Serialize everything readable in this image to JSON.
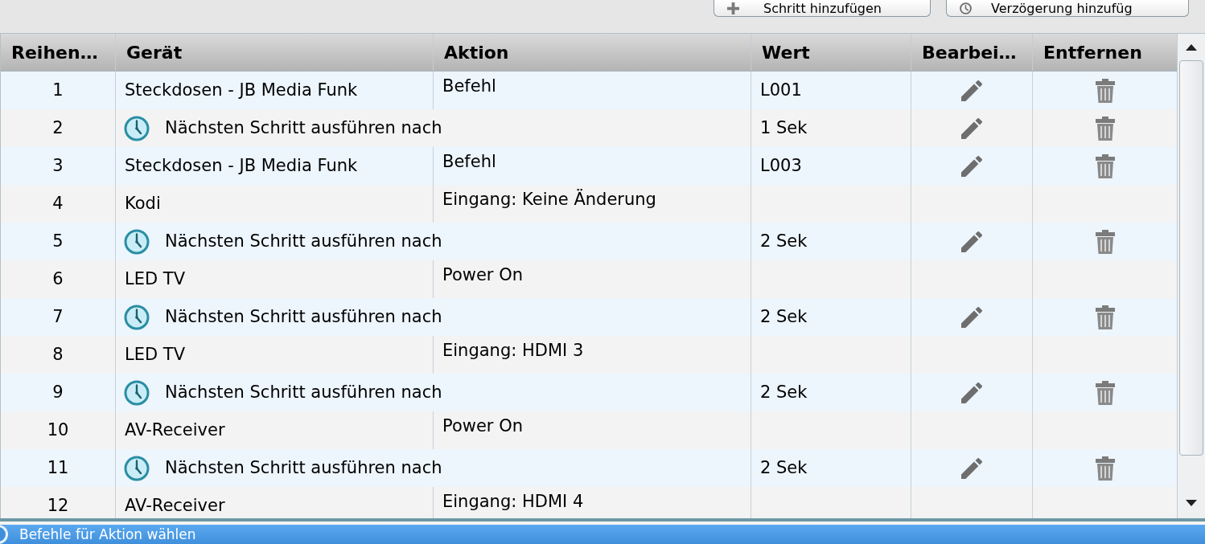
{
  "toolbar": {
    "buttons": [
      {
        "kind": "add",
        "label": "Schritt hinzufügen"
      },
      {
        "kind": "delay",
        "label": "Verzögerung hinzufüg"
      }
    ]
  },
  "table": {
    "columns": [
      "Reihen…",
      "Gerät",
      "Aktion",
      "Wert",
      "Bearbei…",
      "Entfernen"
    ],
    "rows": [
      {
        "kind": "device",
        "number": "1",
        "device": "Steckdosen - JB Media Funk",
        "action": "Befehl",
        "value": "L001",
        "editable": true,
        "removable": true
      },
      {
        "kind": "delay",
        "number": "2",
        "label": "Nächsten Schritt ausführen nach",
        "value": "1 Sek",
        "editable": true,
        "removable": true
      },
      {
        "kind": "device",
        "number": "3",
        "device": "Steckdosen - JB Media Funk",
        "action": "Befehl",
        "value": "L003",
        "editable": true,
        "removable": true
      },
      {
        "kind": "device",
        "number": "4",
        "device": "Kodi",
        "action": "Eingang: Keine Änderung",
        "editable": false,
        "removable": false
      },
      {
        "kind": "delay",
        "number": "5",
        "label": "Nächsten Schritt ausführen nach",
        "value": "2 Sek",
        "editable": true,
        "removable": true
      },
      {
        "kind": "device",
        "number": "6",
        "device": "LED TV",
        "action": "Power On",
        "editable": false,
        "removable": false
      },
      {
        "kind": "delay",
        "number": "7",
        "label": "Nächsten Schritt ausführen nach",
        "value": "2 Sek",
        "editable": true,
        "removable": true
      },
      {
        "kind": "device",
        "number": "8",
        "device": "LED TV",
        "action": "Eingang: HDMI 3",
        "editable": false,
        "removable": false
      },
      {
        "kind": "delay",
        "number": "9",
        "label": "Nächsten Schritt ausführen nach",
        "value": "2 Sek",
        "editable": true,
        "removable": true
      },
      {
        "kind": "device",
        "number": "10",
        "device": "AV-Receiver",
        "action": "Power On",
        "editable": false,
        "removable": false
      },
      {
        "kind": "delay",
        "number": "11",
        "label": "Nächsten Schritt ausführen nach",
        "value": "2 Sek",
        "editable": true,
        "removable": true
      },
      {
        "kind": "device",
        "number": "12",
        "device": "AV-Receiver",
        "action": "Eingang: HDMI 4",
        "editable": false,
        "removable": false
      }
    ]
  },
  "bottom_panel": {
    "title": "Befehle für Aktion wählen"
  }
}
